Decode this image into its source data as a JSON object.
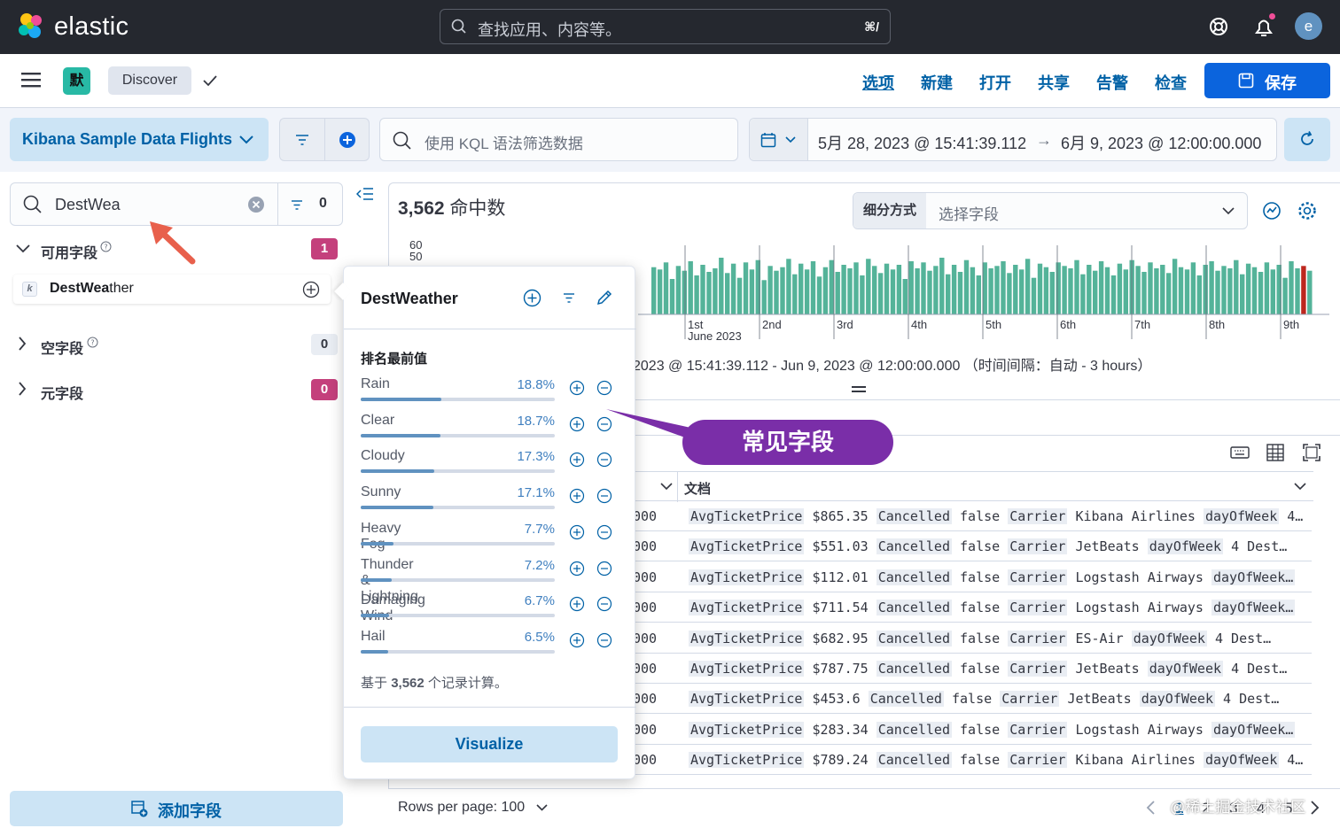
{
  "header": {
    "brand": "elastic",
    "search_placeholder": "查找应用、内容等。",
    "search_shortcut": "⌘/",
    "avatar_letter": "e"
  },
  "appbar": {
    "space_letter": "默",
    "breadcrumb": "Discover",
    "menu": [
      "选项",
      "新建",
      "打开",
      "共享",
      "告警",
      "检查"
    ],
    "save_label": "保存"
  },
  "query": {
    "data_view": "Kibana Sample Data Flights",
    "kql_placeholder": "使用 KQL 语法筛选数据",
    "date_start": "5月 28, 2023 @ 15:41:39.112",
    "date_arrow": "→",
    "date_end": "6月 9, 2023 @ 12:00:00.000"
  },
  "sidebar": {
    "search_value": "DestWea",
    "filter_count": "0",
    "available_label": "可用字段",
    "available_count": "1",
    "field_type": "k",
    "field_match": "DestWea",
    "field_rest": "ther",
    "empty_label": "空字段",
    "empty_count": "0",
    "meta_label": "元字段",
    "meta_count": "0",
    "add_field_label": "添加字段"
  },
  "main": {
    "hits_count": "3,562",
    "hits_label": "命中数",
    "breakdown_label": "细分方式",
    "breakdown_placeholder": "选择字段",
    "time_range": "2023 @ 15:41:39.112 - Jun 9, 2023 @ 12:00:00.000 （时间间隔：自动 - 3 hours）",
    "doc_header": "文档",
    "rows_per_page": "Rows per page: 100",
    "pages": [
      "1",
      "2",
      "3",
      "4",
      "5"
    ]
  },
  "chart_data": {
    "type": "bar",
    "y_ticks": [
      "60",
      "50"
    ],
    "x_ticks": [
      "1st",
      "2nd",
      "3rd",
      "4th",
      "5th",
      "6th",
      "7th",
      "8th",
      "9th"
    ],
    "x_sub": "June 2023",
    "values": [
      40,
      38,
      44,
      30,
      41,
      37,
      45,
      33,
      42,
      36,
      39,
      48,
      35,
      43,
      31,
      44,
      38,
      46,
      29,
      41,
      37,
      40,
      47,
      34,
      43,
      38,
      45,
      32,
      40,
      46,
      36,
      42,
      39,
      44,
      33,
      47,
      41,
      35,
      43,
      38,
      42,
      30,
      45,
      39,
      44,
      37,
      41,
      48,
      34,
      42,
      36,
      46,
      40,
      33,
      44,
      39,
      41,
      45,
      35,
      42,
      38,
      47,
      31,
      43,
      40,
      36,
      44,
      41,
      39,
      46,
      34,
      42,
      37,
      45,
      40,
      33,
      43,
      38,
      46,
      41,
      36,
      44,
      39,
      42,
      35,
      47,
      40,
      38,
      44,
      33,
      42,
      45,
      37,
      41,
      39,
      46,
      34,
      43,
      40,
      36,
      44,
      38,
      42,
      31,
      45,
      39,
      41,
      37
    ],
    "ylim": [
      0,
      60
    ],
    "color": "#54b399",
    "marker_color": "#bd271e"
  },
  "table": {
    "timestamps": [
      "000",
      "000",
      "000",
      "000",
      "000",
      "000",
      "000",
      "000",
      "000"
    ],
    "rows": [
      [
        "AvgTicketPrice",
        "$865.35",
        "Cancelled",
        "false",
        "Carrier",
        "Kibana Airlines",
        "dayOfWeek",
        "4…"
      ],
      [
        "AvgTicketPrice",
        "$551.03",
        "Cancelled",
        "false",
        "Carrier",
        "JetBeats",
        "dayOfWeek",
        "4 Dest…"
      ],
      [
        "AvgTicketPrice",
        "$112.01",
        "Cancelled",
        "false",
        "Carrier",
        "Logstash Airways",
        "dayOfWeek…",
        ""
      ],
      [
        "AvgTicketPrice",
        "$711.54",
        "Cancelled",
        "false",
        "Carrier",
        "Logstash Airways",
        "dayOfWeek…",
        ""
      ],
      [
        "AvgTicketPrice",
        "$682.95",
        "Cancelled",
        "false",
        "Carrier",
        "ES-Air",
        "dayOfWeek",
        "4 Dest…"
      ],
      [
        "AvgTicketPrice",
        "$787.75",
        "Cancelled",
        "false",
        "Carrier",
        "JetBeats",
        "dayOfWeek",
        "4 Dest…"
      ],
      [
        "AvgTicketPrice",
        "$453.6",
        "Cancelled",
        "false",
        "Carrier",
        "JetBeats",
        "dayOfWeek",
        "4 Dest…"
      ],
      [
        "AvgTicketPrice",
        "$283.34",
        "Cancelled",
        "false",
        "Carrier",
        "Logstash Airways",
        "dayOfWeek…",
        ""
      ],
      [
        "AvgTicketPrice",
        "$789.24",
        "Cancelled",
        "false",
        "Carrier",
        "Kibana Airlines",
        "dayOfWeek",
        "4…"
      ]
    ]
  },
  "popover": {
    "title": "DestWeather",
    "subtitle": "排名最前值",
    "note_prefix": "基于",
    "note_count": "3,562",
    "note_suffix": "个记录计算。",
    "visualize_label": "Visualize",
    "top_values": [
      {
        "name": "Rain",
        "pct": "18.8%",
        "frac": 0.188
      },
      {
        "name": "Clear",
        "pct": "18.7%",
        "frac": 0.187
      },
      {
        "name": "Cloudy",
        "pct": "17.3%",
        "frac": 0.173
      },
      {
        "name": "Sunny",
        "pct": "17.1%",
        "frac": 0.171
      },
      {
        "name": "Heavy Fog",
        "pct": "7.7%",
        "frac": 0.077
      },
      {
        "name": "Thunder & Lightning",
        "pct": "7.2%",
        "frac": 0.072
      },
      {
        "name": "Damaging Wind",
        "pct": "6.7%",
        "frac": 0.067
      },
      {
        "name": "Hail",
        "pct": "6.5%",
        "frac": 0.065
      }
    ]
  },
  "annotation": {
    "callout": "常见字段",
    "arrow_color": "#e8604c",
    "callout_color": "#7a2ea8"
  },
  "watermark": "@稀土掘金技术社区"
}
